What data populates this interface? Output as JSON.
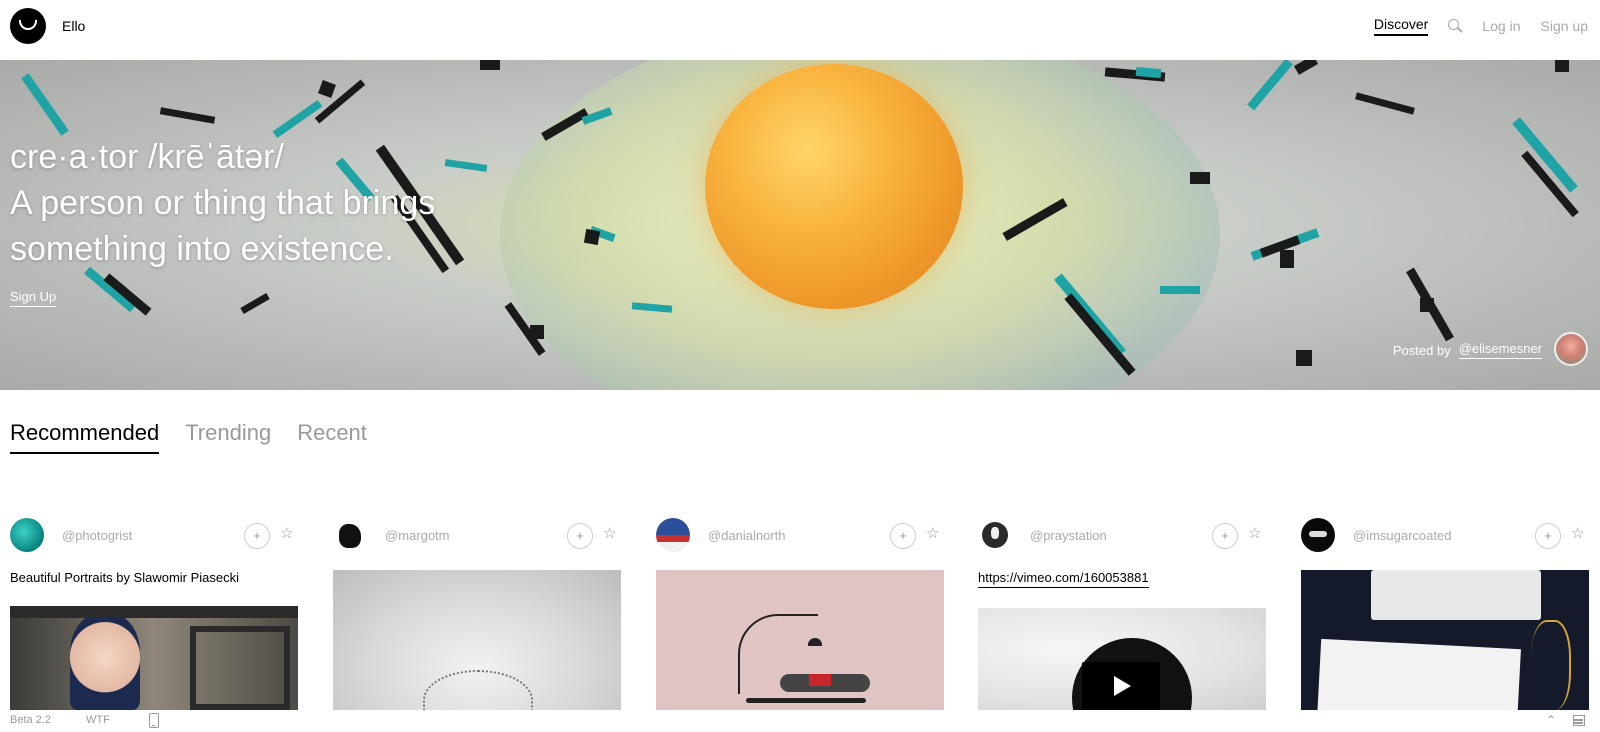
{
  "header": {
    "brand": "Ello",
    "nav": {
      "discover": "Discover",
      "login": "Log in",
      "signup": "Sign up"
    }
  },
  "hero": {
    "line1": "cre·a·tor /krēˈātər/",
    "line2": "A person or thing that brings",
    "line3": "something into existence.",
    "signup": "Sign Up",
    "posted_by": "Posted by",
    "author": "@elisemesner"
  },
  "tabs": [
    {
      "label": "Recommended",
      "active": true
    },
    {
      "label": "Trending",
      "active": false
    },
    {
      "label": "Recent",
      "active": false
    }
  ],
  "posts": [
    {
      "user": "@photogrist",
      "caption": "Beautiful Portraits by Slawomir Piasecki",
      "follow": "+",
      "star": "☆"
    },
    {
      "user": "@margotm",
      "caption": "",
      "follow": "+",
      "star": "☆"
    },
    {
      "user": "@danialnorth",
      "caption": "",
      "follow": "+",
      "star": "☆"
    },
    {
      "user": "@praystation",
      "link": "https://vimeo.com/160053881",
      "follow": "+",
      "star": "☆"
    },
    {
      "user": "@imsugarcoated",
      "caption": "",
      "follow": "+",
      "star": "☆"
    }
  ],
  "footer": {
    "beta": "Beta 2.2",
    "wtf": "WTF",
    "up": "⌃"
  },
  "icons": [
    "ello-logo-icon",
    "search-icon",
    "plus-icon",
    "star-icon",
    "play-icon",
    "phone-icon",
    "chevron-up-icon",
    "grid-icon"
  ]
}
